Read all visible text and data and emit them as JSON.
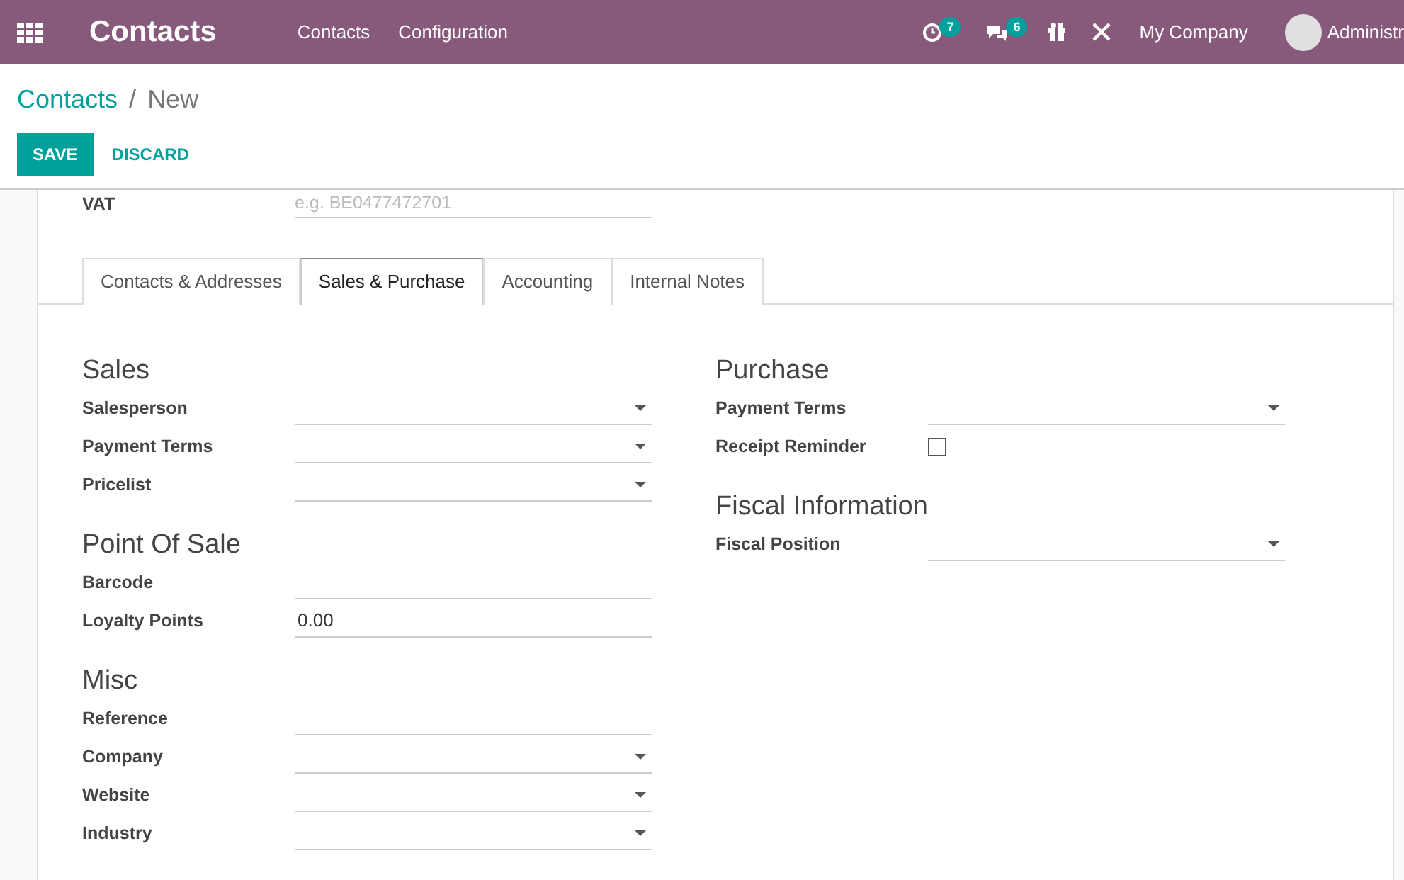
{
  "navbar": {
    "app_title": "Contacts",
    "menu": [
      "Contacts",
      "Configuration"
    ],
    "activity_count": "7",
    "message_count": "6",
    "company": "My Company",
    "user": "Administr"
  },
  "breadcrumb": {
    "parent": "Contacts",
    "separator": "/",
    "current": "New"
  },
  "buttons": {
    "save": "SAVE",
    "discard": "DISCARD"
  },
  "vat": {
    "label": "VAT",
    "placeholder": "e.g. BE0477472701"
  },
  "tabs": [
    {
      "label": "Contacts & Addresses",
      "selected": false
    },
    {
      "label": "Sales & Purchase",
      "selected": true
    },
    {
      "label": "Accounting",
      "selected": false
    },
    {
      "label": "Internal Notes",
      "selected": false
    }
  ],
  "left_groups": [
    {
      "title": "Sales",
      "fields": [
        {
          "label": "Salesperson",
          "kind": "select"
        },
        {
          "label": "Payment Terms",
          "kind": "select"
        },
        {
          "label": "Pricelist",
          "kind": "select"
        }
      ]
    },
    {
      "title": "Point Of Sale",
      "fields": [
        {
          "label": "Barcode",
          "kind": "text"
        },
        {
          "label": "Loyalty Points",
          "kind": "text",
          "value": "0.00"
        }
      ]
    },
    {
      "title": "Misc",
      "fields": [
        {
          "label": "Reference",
          "kind": "text"
        },
        {
          "label": "Company",
          "kind": "select"
        },
        {
          "label": "Website",
          "kind": "select"
        },
        {
          "label": "Industry",
          "kind": "select"
        }
      ]
    }
  ],
  "right_groups": [
    {
      "title": "Purchase",
      "fields": [
        {
          "label": "Payment Terms",
          "kind": "select"
        },
        {
          "label": "Receipt Reminder",
          "kind": "checkbox",
          "checked": false
        }
      ]
    },
    {
      "title": "Fiscal Information",
      "fields": [
        {
          "label": "Fiscal Position",
          "kind": "select"
        }
      ]
    }
  ]
}
